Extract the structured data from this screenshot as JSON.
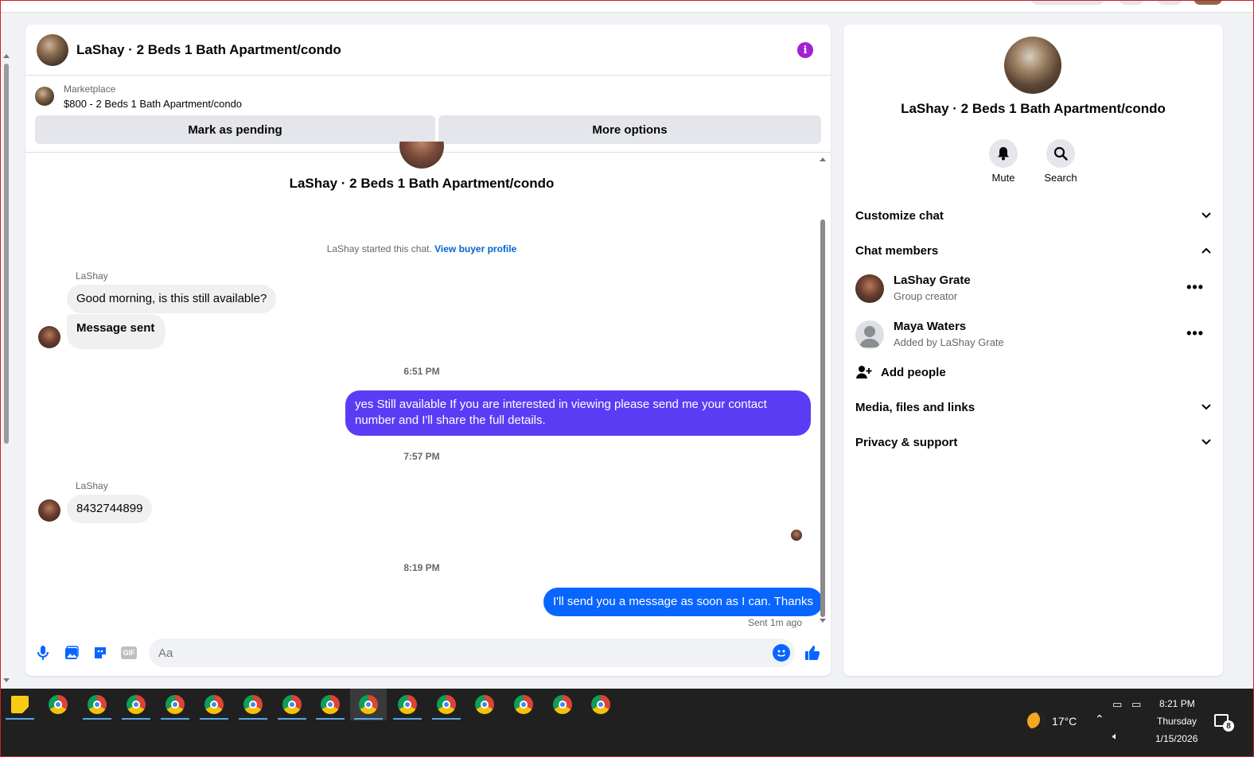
{
  "chat": {
    "header_title": "LaShay · 2 Beds 1 Bath Apartment/condo",
    "marketplace_label": "Marketplace",
    "marketplace_title": "$800 - 2 Beds 1 Bath Apartment/condo",
    "mark_pending": "Mark as pending",
    "more_options": "More options"
  },
  "thread": {
    "title": "LaShay · 2 Beds 1 Bath Apartment/condo",
    "started_text": "LaShay started this chat. ",
    "view_profile": "View buyer profile",
    "messages": [
      {
        "sender": "LaShay",
        "text": "Good morning, is this still available?"
      },
      {
        "text": "Message sent"
      },
      {
        "time": "6:51 PM"
      },
      {
        "text": "yes Still available If you are interested in viewing please send me your contact number and I'll share the full details."
      },
      {
        "time": "7:57 PM"
      },
      {
        "sender": "LaShay",
        "text": "8432744899"
      },
      {
        "time": "8:19 PM"
      },
      {
        "text": "I'll send you a message as soon as I can. Thanks"
      }
    ],
    "sent_status": "Sent 1m ago"
  },
  "composer": {
    "placeholder": "Aa",
    "gif_label": "GIF"
  },
  "panel": {
    "title": "LaShay · 2 Beds 1 Bath Apartment/condo",
    "mute": "Mute",
    "search": "Search",
    "customize_chat": "Customize chat",
    "chat_members": "Chat members",
    "members": [
      {
        "name": "LaShay Grate",
        "role": "Group creator"
      },
      {
        "name": "Maya Waters",
        "role": "Added by LaShay Grate"
      }
    ],
    "add_people": "Add people",
    "media": "Media, files and links",
    "privacy": "Privacy & support"
  },
  "taskbar": {
    "temperature": "17°C",
    "time": "8:21 PM",
    "day": "Thursday",
    "date": "1/15/2026",
    "notifications": "8"
  },
  "colors": {
    "accent_blue": "#0866ff",
    "accent_purple": "#5b3cf5",
    "info_purple": "#a21fd6"
  }
}
